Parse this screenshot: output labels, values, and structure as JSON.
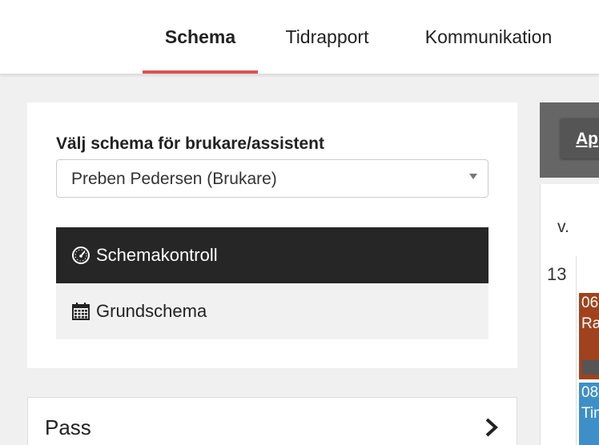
{
  "nav": {
    "tabs": [
      {
        "label": "Schema",
        "active": true
      },
      {
        "label": "Tidrapport",
        "active": false
      },
      {
        "label": "Kommunikation",
        "active": false
      }
    ],
    "accent_color": "#d9534f"
  },
  "schedule_panel": {
    "select_label": "Välj schema för brukare/assistent",
    "select_value": "Preben Pedersen (Brukare)",
    "menu": [
      {
        "label": "Schemakontroll",
        "icon": "dashboard-icon",
        "active": true
      },
      {
        "label": "Grundschema",
        "icon": "calendar-icon",
        "active": false
      }
    ]
  },
  "pass_panel": {
    "label": "Pass",
    "icon": "chevron-right-icon"
  },
  "calendar": {
    "button_label": "Ap",
    "week_label": "v.",
    "week_number": "13",
    "events": [
      {
        "line1": "06",
        "line2": "Ra",
        "color": "#a0421d"
      },
      {
        "line1": "08",
        "line2": "Tin",
        "color": "#3e8fc8"
      }
    ]
  }
}
